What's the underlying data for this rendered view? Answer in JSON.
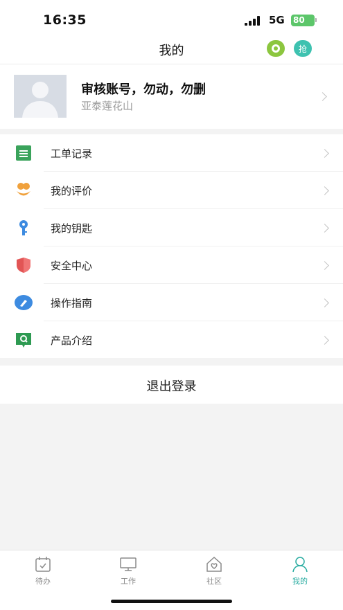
{
  "status_bar": {
    "time": "16:35",
    "network": "5G",
    "battery": "80"
  },
  "header": {
    "title": "我的",
    "grab_button": "抢"
  },
  "profile": {
    "name": "审核账号，勿动，勿删",
    "subtitle": "亚泰莲花山"
  },
  "menu": {
    "items": [
      {
        "label": "工单记录",
        "icon": "work-order-icon",
        "color": "#3aa35b"
      },
      {
        "label": "我的评价",
        "icon": "flower-icon",
        "color": "#f0a13c"
      },
      {
        "label": "我的钥匙",
        "icon": "key-icon",
        "color": "#3d8be0"
      },
      {
        "label": "安全中心",
        "icon": "shield-icon",
        "color": "#e25555"
      },
      {
        "label": "操作指南",
        "icon": "guide-icon",
        "color": "#3d8be0"
      },
      {
        "label": "产品介绍",
        "icon": "product-icon",
        "color": "#2e9a52"
      }
    ]
  },
  "logout": {
    "label": "退出登录"
  },
  "tabs": [
    {
      "label": "待办",
      "icon": "calendar-check-icon",
      "active": false
    },
    {
      "label": "工作",
      "icon": "monitor-icon",
      "active": false
    },
    {
      "label": "社区",
      "icon": "community-home-icon",
      "active": false
    },
    {
      "label": "我的",
      "icon": "person-icon",
      "active": true
    }
  ],
  "colors": {
    "accent": "#27aba0",
    "background": "#f3f3f3"
  }
}
